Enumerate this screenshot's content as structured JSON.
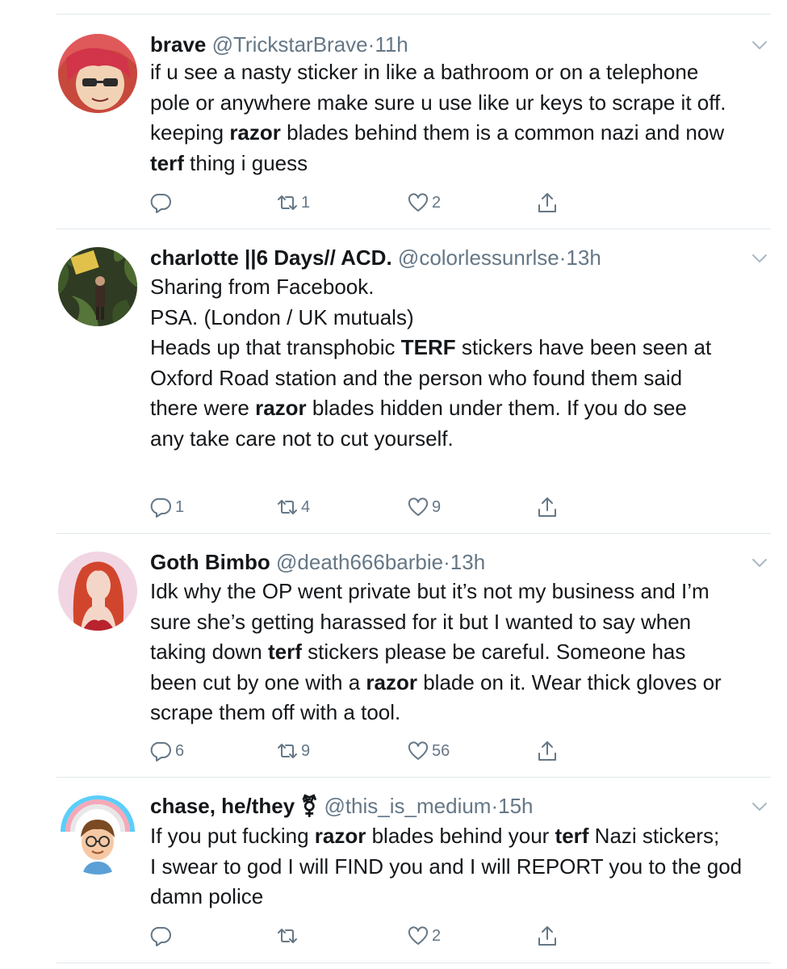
{
  "tweets": [
    {
      "name": "brave",
      "handle": "@TrickstarBrave",
      "dot": "·",
      "time": "11h",
      "lines": [
        [
          {
            "t": "if u see a nasty sticker in like a bathroom or on a telephone"
          }
        ],
        [
          {
            "t": "pole or anywhere make sure u use like ur keys to scrape it off."
          }
        ],
        [
          {
            "t": "keeping "
          },
          {
            "t": "razor",
            "b": true
          },
          {
            "t": " blades behind them is a common nazi and now"
          }
        ],
        [
          {
            "t": "terf",
            "b": true
          },
          {
            "t": " thing i guess"
          }
        ]
      ],
      "replies": "",
      "retweets": "1",
      "likes": "2"
    },
    {
      "name": "charlotte ||6 Days// ACD.",
      "handle": "@colorlessunrlse",
      "dot": "·",
      "time": "13h",
      "lines": [
        [
          {
            "t": "Sharing from Facebook."
          }
        ],
        [
          {
            "t": " "
          }
        ],
        [
          {
            "t": "PSA. (London / UK mutuals)"
          }
        ],
        [
          {
            "t": "Heads up that transphobic "
          },
          {
            "t": "TERF",
            "b": true
          },
          {
            "t": " stickers have been seen at"
          }
        ],
        [
          {
            "t": "Oxford Road station and the person who found them said"
          }
        ],
        [
          {
            "t": "there were "
          },
          {
            "t": "razor",
            "b": true
          },
          {
            "t": " blades hidden under them.  If you do see"
          }
        ],
        [
          {
            "t": "any take care not to cut yourself."
          }
        ]
      ],
      "replies": "1",
      "retweets": "4",
      "likes": "9"
    },
    {
      "name": "Goth Bimbo",
      "handle": "@death666barbie",
      "dot": "·",
      "time": "13h",
      "lines": [
        [
          {
            "t": "Idk why the OP went private but it’s not my business and I’m"
          }
        ],
        [
          {
            "t": "sure she’s getting harassed for it but I wanted to say when"
          }
        ],
        [
          {
            "t": "taking down "
          },
          {
            "t": "terf",
            "b": true
          },
          {
            "t": " stickers please be careful. Someone has"
          }
        ],
        [
          {
            "t": "been cut by one with a "
          },
          {
            "t": "razor",
            "b": true
          },
          {
            "t": " blade on it. Wear thick gloves or"
          }
        ],
        [
          {
            "t": "scrape them off with a tool."
          }
        ]
      ],
      "replies": "6",
      "retweets": "9",
      "likes": "56"
    },
    {
      "name": "chase, he/they ⚧",
      "handle": "@this_is_medium",
      "dot": "·",
      "time": "15h",
      "lines": [
        [
          {
            "t": "If you put fucking "
          },
          {
            "t": "razor",
            "b": true
          },
          {
            "t": " blades behind your "
          },
          {
            "t": "terf",
            "b": true
          },
          {
            "t": " Nazi stickers;"
          }
        ],
        [
          {
            "t": "I swear to god I will FIND you and I will REPORT you to the god"
          }
        ],
        [
          {
            "t": "damn police"
          }
        ]
      ],
      "replies": "",
      "retweets": "",
      "likes": "2"
    }
  ],
  "icons": {
    "reply": "reply-icon",
    "retweet": "retweet-icon",
    "like": "heart-icon",
    "share": "share-icon",
    "menu": "chevron-down-icon"
  },
  "colors": {
    "text": "#14171a",
    "secondary": "#657786",
    "divider": "#e1e8ed"
  }
}
